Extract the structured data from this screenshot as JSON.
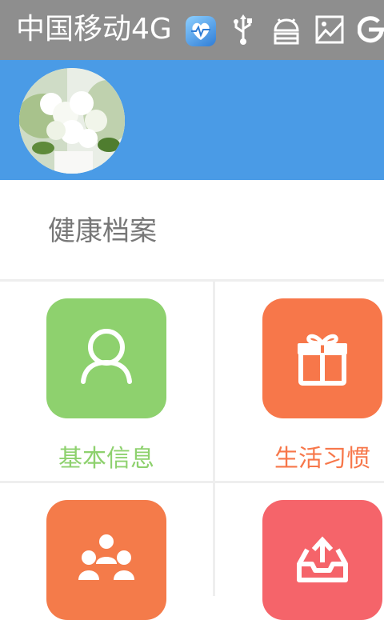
{
  "status_bar": {
    "carrier": "中国移动4G",
    "icons": [
      "health-app-icon",
      "usb-icon",
      "android-debug-icon",
      "image-icon",
      "sync-icon"
    ]
  },
  "header": {
    "avatar": "flower-avatar"
  },
  "section": {
    "title": "健康档案"
  },
  "grid": {
    "items": [
      {
        "label": "基本信息",
        "icon": "person-icon",
        "color": "#8ed16e"
      },
      {
        "label": "生活习惯",
        "icon": "gift-icon",
        "color": "#f7774a"
      },
      {
        "label": "",
        "icon": "family-icon",
        "color": "#f47b4a"
      },
      {
        "label": "",
        "icon": "upload-tray-icon",
        "color": "#f5646a"
      }
    ]
  },
  "colors": {
    "status_bar": "#8e8e8e",
    "header": "#4a9be6"
  }
}
